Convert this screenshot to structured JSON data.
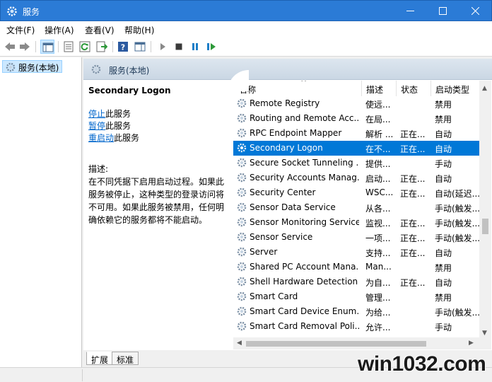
{
  "window": {
    "title": "服务"
  },
  "menu": [
    "文件(F)",
    "操作(A)",
    "查看(V)",
    "帮助(H)"
  ],
  "tree": {
    "selected": "服务(本地)"
  },
  "pane": {
    "header": "服务(本地)"
  },
  "details": {
    "service_title": "Secondary Logon",
    "actions": [
      {
        "link": "停止",
        "rest": "此服务"
      },
      {
        "link": "暂停",
        "rest": "此服务"
      },
      {
        "link": "重启动",
        "rest": "此服务"
      }
    ],
    "desc_label": "描述:",
    "desc_lines": [
      "在不同凭据下启用启动过程。如果此",
      "服务被停止，这种类型的登录访问将",
      "不可用。如果此服务被禁用，任何明",
      "确依赖它的服务都将不能启动。"
    ]
  },
  "columns": {
    "name": "名称",
    "desc": "描述",
    "status": "状态",
    "startup": "启动类型"
  },
  "rows": [
    {
      "name": "Remote Registry",
      "desc": "使远...",
      "status": "",
      "startup": "禁用"
    },
    {
      "name": "Routing and Remote Acc...",
      "desc": "在局...",
      "status": "",
      "startup": "禁用"
    },
    {
      "name": "RPC Endpoint Mapper",
      "desc": "解析 ...",
      "status": "正在...",
      "startup": "自动"
    },
    {
      "name": "Secondary Logon",
      "desc": "在不...",
      "status": "正在...",
      "startup": "自动"
    },
    {
      "name": "Secure Socket Tunneling ...",
      "desc": "提供...",
      "status": "",
      "startup": "手动"
    },
    {
      "name": "Security Accounts Manag...",
      "desc": "启动...",
      "status": "正在...",
      "startup": "自动"
    },
    {
      "name": "Security Center",
      "desc": "WSC...",
      "status": "正在...",
      "startup": "自动(延迟..."
    },
    {
      "name": "Sensor Data Service",
      "desc": "从各...",
      "status": "",
      "startup": "手动(触发..."
    },
    {
      "name": "Sensor Monitoring Service",
      "desc": "监视...",
      "status": "正在...",
      "startup": "手动(触发..."
    },
    {
      "name": "Sensor Service",
      "desc": "一项...",
      "status": "正在...",
      "startup": "手动(触发..."
    },
    {
      "name": "Server",
      "desc": "支持...",
      "status": "正在...",
      "startup": "自动"
    },
    {
      "name": "Shared PC Account Mana...",
      "desc": "Man...",
      "status": "",
      "startup": "禁用"
    },
    {
      "name": "Shell Hardware Detection",
      "desc": "为自...",
      "status": "正在...",
      "startup": "自动"
    },
    {
      "name": "Smart Card",
      "desc": "管理...",
      "status": "",
      "startup": "禁用"
    },
    {
      "name": "Smart Card Device Enum...",
      "desc": "为给...",
      "status": "",
      "startup": "手动(触发..."
    },
    {
      "name": "Smart Card Removal Poli...",
      "desc": "允许...",
      "status": "",
      "startup": "手动"
    }
  ],
  "selected_row": 3,
  "tabs": [
    "扩展",
    "标准"
  ],
  "watermark": "win1032.com",
  "colors": {
    "titlebar": "#2b7bd6",
    "selection": "#0078d7",
    "link": "#0066cc"
  }
}
